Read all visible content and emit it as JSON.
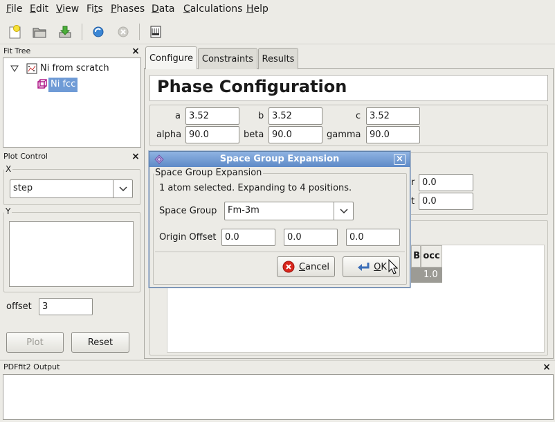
{
  "menu": {
    "items": [
      {
        "pre": "",
        "u": "F",
        "post": "ile"
      },
      {
        "pre": "",
        "u": "E",
        "post": "dit"
      },
      {
        "pre": "",
        "u": "V",
        "post": "iew"
      },
      {
        "pre": "Fi",
        "u": "t",
        "post": "s"
      },
      {
        "pre": "",
        "u": "P",
        "post": "hases"
      },
      {
        "pre": "",
        "u": "D",
        "post": "ata"
      },
      {
        "pre": "",
        "u": "C",
        "post": "alculations"
      },
      {
        "pre": "",
        "u": "H",
        "post": "elp"
      }
    ]
  },
  "fit_tree": {
    "title": "Fit Tree",
    "fit_label": "Ni from scratch",
    "phase_label": "Ni fcc"
  },
  "plot_control": {
    "title": "Plot Control",
    "x_label": "X",
    "x_value": "step",
    "y_label": "Y",
    "offset_label": "offset",
    "offset_value": "3",
    "plot_button": "Plot",
    "reset_button": "Reset"
  },
  "tabs": [
    "Configure",
    "Constraints",
    "Results"
  ],
  "phase": {
    "heading": "Phase Configuration",
    "a_label": "a",
    "a_value": "3.52",
    "b_label": "b",
    "b_value": "3.52",
    "c_label": "c",
    "c_value": "3.52",
    "alpha_label": "alpha",
    "alpha_value": "90.0",
    "beta_label": "beta",
    "beta_value": "90.0",
    "gamma_label": "gamma",
    "gamma_value": "90.0",
    "r_label": "r",
    "r_value": "0.0",
    "t_label": "t",
    "t_value": "0.0",
    "table": {
      "headers": [
        "B",
        "occ"
      ],
      "row": [
        "",
        "1.0"
      ]
    }
  },
  "output": {
    "title": "PDFfit2 Output"
  },
  "dialog": {
    "title": "Space Group Expansion",
    "group_label": "Space Group Expansion",
    "message": "1 atom selected.  Expanding to 4 positions.",
    "space_group_label": "Space Group",
    "space_group_value": "Fm-3m",
    "origin_offset_label": "Origin Offset",
    "offset_x": "0.0",
    "offset_y": "0.0",
    "offset_z": "0.0",
    "cancel_pre": "",
    "cancel_u": "C",
    "cancel_post": "ancel",
    "ok_pre": "",
    "ok_u": "O",
    "ok_post": "K"
  }
}
